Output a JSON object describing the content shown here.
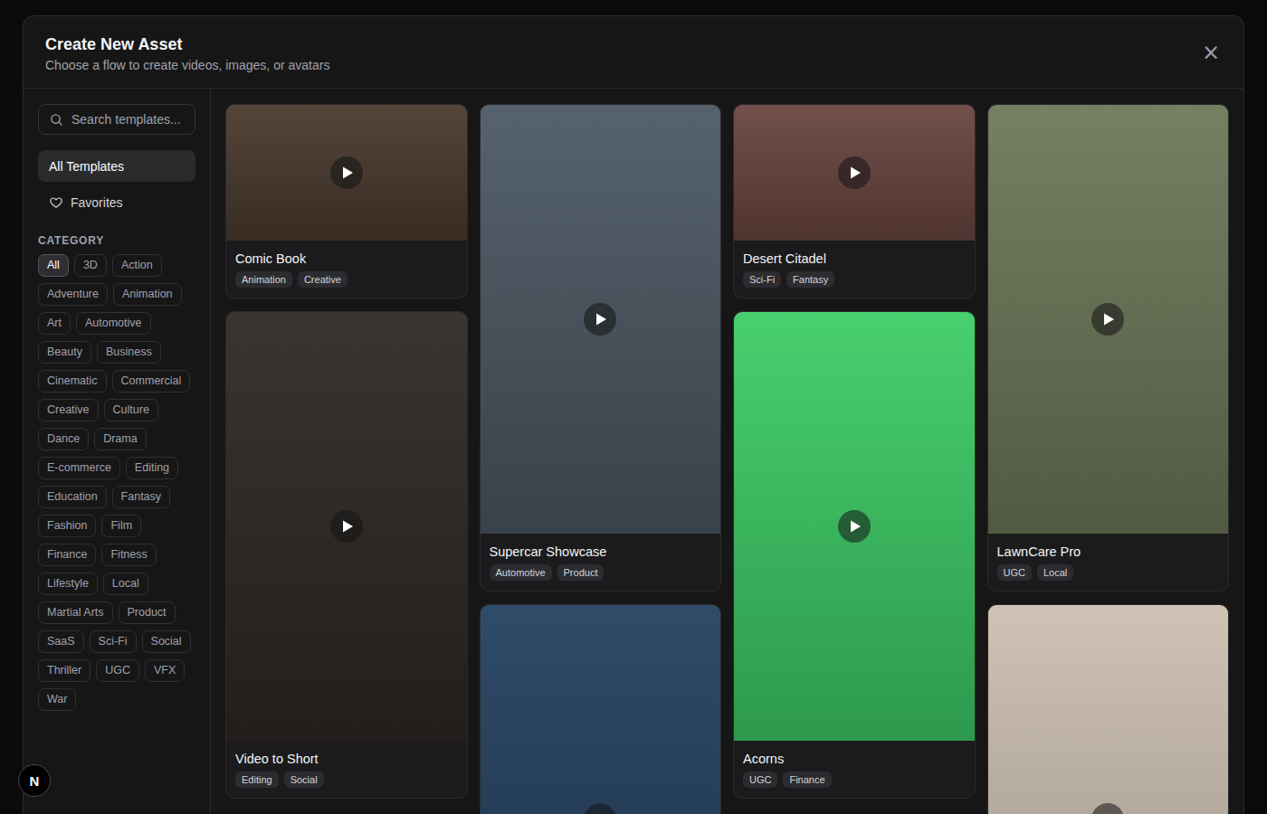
{
  "dialog": {
    "title": "Create New Asset",
    "subtitle": "Choose a flow to create videos, images, or avatars",
    "close": "×"
  },
  "search": {
    "placeholder": "Search templates..."
  },
  "nav": [
    {
      "label": "All Templates",
      "kind": "all",
      "selected": true
    },
    {
      "label": "Favorites",
      "kind": "favorites",
      "selected": false
    }
  ],
  "category": {
    "label": "CATEGORY",
    "items": [
      {
        "label": "All",
        "selected": true
      },
      {
        "label": "3D",
        "selected": false
      },
      {
        "label": "Action",
        "selected": false
      },
      {
        "label": "Adventure",
        "selected": false
      },
      {
        "label": "Animation",
        "selected": false
      },
      {
        "label": "Art",
        "selected": false
      },
      {
        "label": "Automotive",
        "selected": false
      },
      {
        "label": "Beauty",
        "selected": false
      },
      {
        "label": "Business",
        "selected": false
      },
      {
        "label": "Cinematic",
        "selected": false
      },
      {
        "label": "Commercial",
        "selected": false
      },
      {
        "label": "Creative",
        "selected": false
      },
      {
        "label": "Culture",
        "selected": false
      },
      {
        "label": "Dance",
        "selected": false
      },
      {
        "label": "Drama",
        "selected": false
      },
      {
        "label": "E-commerce",
        "selected": false
      },
      {
        "label": "Editing",
        "selected": false
      },
      {
        "label": "Education",
        "selected": false
      },
      {
        "label": "Fantasy",
        "selected": false
      },
      {
        "label": "Fashion",
        "selected": false
      },
      {
        "label": "Film",
        "selected": false
      },
      {
        "label": "Finance",
        "selected": false
      },
      {
        "label": "Fitness",
        "selected": false
      },
      {
        "label": "Lifestyle",
        "selected": false
      },
      {
        "label": "Local",
        "selected": false
      },
      {
        "label": "Martial Arts",
        "selected": false
      },
      {
        "label": "Product",
        "selected": false
      },
      {
        "label": "SaaS",
        "selected": false
      },
      {
        "label": "Sci-Fi",
        "selected": false
      },
      {
        "label": "Social",
        "selected": false
      },
      {
        "label": "Thriller",
        "selected": false
      },
      {
        "label": "UGC",
        "selected": false
      },
      {
        "label": "VFX",
        "selected": false
      },
      {
        "label": "War",
        "selected": false
      }
    ]
  },
  "columns": [
    [
      {
        "title": "Comic Book",
        "tags": [
          "Animation",
          "Creative"
        ],
        "kind": "wide",
        "color": "#4a3a2e"
      },
      {
        "title": "Video to Short",
        "tags": [
          "Editing",
          "Social"
        ],
        "kind": "tall",
        "color": "#2e2824"
      }
    ],
    [
      {
        "title": "Supercar Showcase",
        "tags": [
          "Automotive",
          "Product"
        ],
        "kind": "tall",
        "color": "#4b5863"
      },
      {
        "title": "",
        "tags": [],
        "kind": "tall",
        "color": "#23405f"
      }
    ],
    [
      {
        "title": "Desert Citadel",
        "tags": [
          "Sci-Fi",
          "Fantasy"
        ],
        "kind": "wide",
        "color": "#6a4540"
      },
      {
        "title": "Acorns",
        "tags": [
          "UGC",
          "Finance"
        ],
        "kind": "tall",
        "color": "#3ccc66"
      }
    ],
    [
      {
        "title": "LawnCare Pro",
        "tags": [
          "UGC",
          "Local"
        ],
        "kind": "tall",
        "color": "#6d7758"
      },
      {
        "title": "",
        "tags": [],
        "kind": "tall",
        "color": "#cbbfb0"
      }
    ]
  ],
  "dev_badge": "N"
}
